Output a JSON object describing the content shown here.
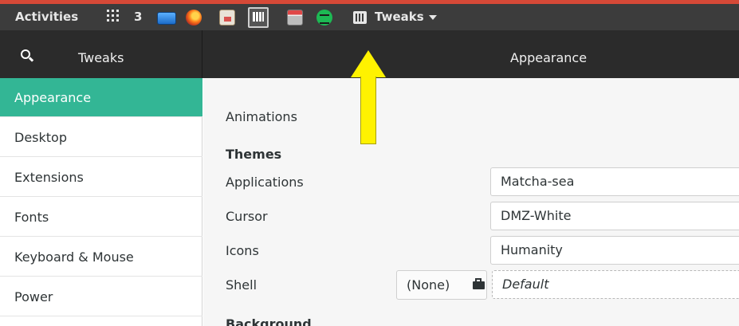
{
  "topbar": {
    "activities": "Activities",
    "workspace_count": "3",
    "app_menu": "Tweaks",
    "icons": [
      "apps-grid-icon",
      "screen-icon",
      "firefox-icon",
      "document-viewer-icon",
      "keyboard-icon",
      "archive-icon",
      "spotify-icon",
      "tweaks-icon"
    ]
  },
  "headerbar": {
    "left_title": "Tweaks",
    "main_title": "Appearance"
  },
  "sidebar": {
    "items": [
      {
        "label": "Appearance",
        "active": true
      },
      {
        "label": "Desktop"
      },
      {
        "label": "Extensions"
      },
      {
        "label": "Fonts"
      },
      {
        "label": "Keyboard & Mouse"
      },
      {
        "label": "Power"
      }
    ]
  },
  "main": {
    "animations_label": "Animations",
    "themes_heading": "Themes",
    "rows": [
      {
        "label": "Applications",
        "value": "Matcha-sea"
      },
      {
        "label": "Cursor",
        "value": "DMZ-White"
      },
      {
        "label": "Icons",
        "value": "Humanity"
      },
      {
        "label": "Shell",
        "value": "Default",
        "file_button": "(None)"
      }
    ],
    "background_heading": "Background"
  },
  "colors": {
    "accent": "#33b695",
    "topbar": "#3c3c3c",
    "headerbar": "#2b2b2b",
    "annotation_arrow": "#fff200"
  }
}
